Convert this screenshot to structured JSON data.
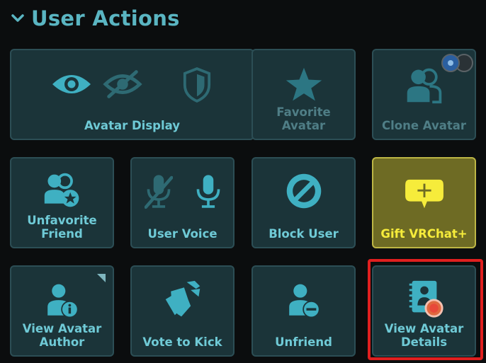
{
  "header": {
    "title": "User Actions",
    "icon": "chevron-down-icon"
  },
  "tiles": {
    "avatar_display": {
      "label": "Avatar Display",
      "icons": [
        "eye-icon",
        "eye-slash-icon",
        "shield-icon"
      ]
    },
    "favorite_avatar": {
      "label": "Favorite\nAvatar",
      "icon": "star-icon"
    },
    "clone_avatar": {
      "label": "Clone Avatar",
      "icon": "users-icon"
    },
    "unfavorite_friend": {
      "label": "Unfavorite\nFriend",
      "icon": "friend-star-icon"
    },
    "user_voice": {
      "label": "User Voice",
      "icons": [
        "mic-muted-icon",
        "mic-icon"
      ]
    },
    "block_user": {
      "label": "Block User",
      "icon": "block-icon"
    },
    "gift_vrchat": {
      "label": "Gift VRChat+",
      "icon": "gift-plus-icon"
    },
    "view_avatar_author": {
      "label": "View Avatar\nAuthor",
      "icon": "user-info-icon"
    },
    "vote_to_kick": {
      "label": "Vote to Kick",
      "icon": "boot-icon"
    },
    "unfriend": {
      "label": "Unfriend",
      "icon": "user-minus-icon"
    },
    "view_avatar_details": {
      "label": "View Avatar\nDetails",
      "icon": "avatar-details-icon"
    }
  },
  "colors": {
    "accent": "#5ab5c2",
    "tile_bg": "#1b3439",
    "gift_bg": "#6e6b24",
    "gift_text": "#f6ec3b",
    "highlight": "#e01f1f"
  }
}
